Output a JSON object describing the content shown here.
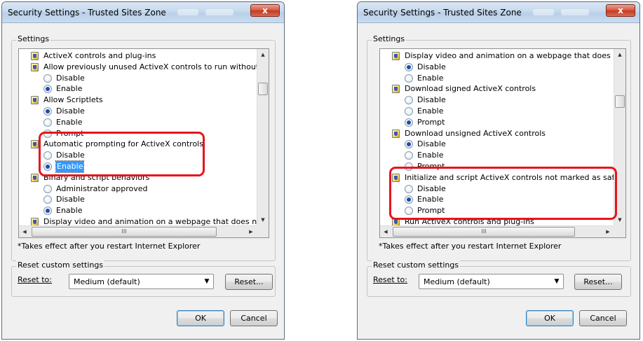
{
  "left_dialog": {
    "title": "Security Settings - Trusted Sites Zone",
    "close_label": "x",
    "settings_label": "Settings",
    "rows": [
      {
        "kind": "category",
        "label": "ActiveX controls and plug-ins"
      },
      {
        "kind": "setting",
        "label": "Allow previously unused ActiveX controls to run without prom"
      },
      {
        "kind": "option",
        "label": "Disable",
        "checked": false
      },
      {
        "kind": "option",
        "label": "Enable",
        "checked": true
      },
      {
        "kind": "setting",
        "label": "Allow Scriptlets"
      },
      {
        "kind": "option",
        "label": "Disable",
        "checked": true
      },
      {
        "kind": "option",
        "label": "Enable",
        "checked": false
      },
      {
        "kind": "option",
        "label": "Prompt",
        "checked": false
      },
      {
        "kind": "setting",
        "label": "Automatic prompting for ActiveX controls"
      },
      {
        "kind": "option",
        "label": "Disable",
        "checked": false
      },
      {
        "kind": "option",
        "label": "Enable",
        "checked": true,
        "selected": true
      },
      {
        "kind": "setting",
        "label": "Binary and script behaviors"
      },
      {
        "kind": "option",
        "label": "Administrator approved",
        "checked": false
      },
      {
        "kind": "option",
        "label": "Disable",
        "checked": false
      },
      {
        "kind": "option",
        "label": "Enable",
        "checked": true
      },
      {
        "kind": "setting",
        "label": "Display video and animation on a webpage that does not use"
      }
    ],
    "note": "*Takes effect after you restart Internet Explorer",
    "reset_group_label": "Reset custom settings",
    "reset_to_label": "Reset to:",
    "reset_to_value": "Medium (default)",
    "reset_button": "Reset...",
    "ok_button": "OK",
    "cancel_button": "Cancel",
    "hscroll_grip": "III"
  },
  "right_dialog": {
    "title": "Security Settings - Trusted Sites Zone",
    "close_label": "x",
    "settings_label": "Settings",
    "rows": [
      {
        "kind": "setting",
        "label": "Display video and animation on a webpage that does not use"
      },
      {
        "kind": "option",
        "label": "Disable",
        "checked": true
      },
      {
        "kind": "option",
        "label": "Enable",
        "checked": false
      },
      {
        "kind": "setting",
        "label": "Download signed ActiveX controls"
      },
      {
        "kind": "option",
        "label": "Disable",
        "checked": false
      },
      {
        "kind": "option",
        "label": "Enable",
        "checked": false
      },
      {
        "kind": "option",
        "label": "Prompt",
        "checked": true
      },
      {
        "kind": "setting",
        "label": "Download unsigned ActiveX controls"
      },
      {
        "kind": "option",
        "label": "Disable",
        "checked": true
      },
      {
        "kind": "option",
        "label": "Enable",
        "checked": false
      },
      {
        "kind": "option",
        "label": "Prompt",
        "checked": false
      },
      {
        "kind": "setting",
        "label": "Initialize and script ActiveX controls not marked as safe for s"
      },
      {
        "kind": "option",
        "label": "Disable",
        "checked": false
      },
      {
        "kind": "option",
        "label": "Enable",
        "checked": true
      },
      {
        "kind": "option",
        "label": "Prompt",
        "checked": false
      },
      {
        "kind": "category",
        "label": "Run ActiveX controls and plug-ins"
      }
    ],
    "note": "*Takes effect after you restart Internet Explorer",
    "reset_group_label": "Reset custom settings",
    "reset_to_label": "Reset to:",
    "reset_to_value": "Medium (default)",
    "reset_button": "Reset...",
    "ok_button": "OK",
    "cancel_button": "Cancel",
    "hscroll_grip": "III"
  },
  "colors": {
    "highlight_outline": "#e8141c",
    "selection": "#3399ff",
    "dialog_face": "#f0f0f0"
  },
  "icons": {
    "setting": "activex-setting-icon",
    "close": "close-icon",
    "dropdown": "chevron-down-icon"
  }
}
